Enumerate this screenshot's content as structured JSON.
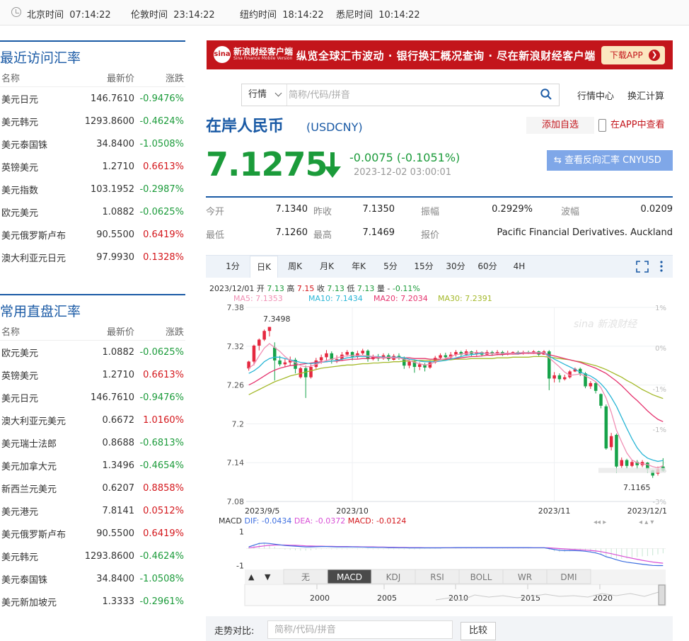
{
  "clocks": [
    {
      "city": "北京时间",
      "time": "07:14:22"
    },
    {
      "city": "伦敦时间",
      "time": "23:14:22"
    },
    {
      "city": "纽约时间",
      "time": "18:14:22"
    },
    {
      "city": "悉尼时间",
      "time": "10:14:22"
    }
  ],
  "recent": {
    "title": "最近访问汇率",
    "headers": [
      "名称",
      "最新价",
      "涨跌"
    ],
    "rows": [
      {
        "name": "美元日元",
        "price": "146.7610",
        "chg": "-0.9476%",
        "dir": "down"
      },
      {
        "name": "美元韩元",
        "price": "1293.8600",
        "chg": "-0.4624%",
        "dir": "down"
      },
      {
        "name": "美元泰国铢",
        "price": "34.8400",
        "chg": "-1.0508%",
        "dir": "down"
      },
      {
        "name": "英镑美元",
        "price": "1.2710",
        "chg": "0.6613%",
        "dir": "up"
      },
      {
        "name": "美元指数",
        "price": "103.1952",
        "chg": "-0.2987%",
        "dir": "down"
      },
      {
        "name": "欧元美元",
        "price": "1.0882",
        "chg": "-0.0625%",
        "dir": "down"
      },
      {
        "name": "美元俄罗斯卢布",
        "price": "90.5500",
        "chg": "0.6419%",
        "dir": "up"
      },
      {
        "name": "澳大利亚元日元",
        "price": "97.9930",
        "chg": "0.1328%",
        "dir": "up"
      }
    ]
  },
  "common": {
    "title": "常用直盘汇率",
    "headers": [
      "名称",
      "最新价",
      "涨跌"
    ],
    "rows": [
      {
        "name": "欧元美元",
        "price": "1.0882",
        "chg": "-0.0625%",
        "dir": "down"
      },
      {
        "name": "英镑美元",
        "price": "1.2710",
        "chg": "0.6613%",
        "dir": "up"
      },
      {
        "name": "美元日元",
        "price": "146.7610",
        "chg": "-0.9476%",
        "dir": "down"
      },
      {
        "name": "澳大利亚元美元",
        "price": "0.6672",
        "chg": "1.0160%",
        "dir": "up"
      },
      {
        "name": "美元瑞士法郎",
        "price": "0.8688",
        "chg": "-0.6813%",
        "dir": "down"
      },
      {
        "name": "美元加拿大元",
        "price": "1.3496",
        "chg": "-0.4654%",
        "dir": "down"
      },
      {
        "name": "新西兰元美元",
        "price": "0.6207",
        "chg": "0.8858%",
        "dir": "up"
      },
      {
        "name": "美元港元",
        "price": "7.8141",
        "chg": "0.0512%",
        "dir": "up"
      },
      {
        "name": "美元俄罗斯卢布",
        "price": "90.5500",
        "chg": "0.6419%",
        "dir": "up"
      },
      {
        "name": "美元韩元",
        "price": "1293.8600",
        "chg": "-0.4624%",
        "dir": "down"
      },
      {
        "name": "美元泰国铢",
        "price": "34.8400",
        "chg": "-1.0508%",
        "dir": "down"
      },
      {
        "name": "美元新加坡元",
        "price": "1.3333",
        "chg": "-0.2961%",
        "dir": "down"
      }
    ]
  },
  "banner": {
    "logo_text": "新浪财经客户端",
    "logo_sub": "Sina Finance Mobile Version",
    "logo_mark": "sina",
    "slogan": "纵览全球汇市波动 · 银行换汇概况查询 · 尽在新浪财经客户端",
    "download": "下载APP",
    "color": "#c3151b"
  },
  "search": {
    "select": "行情",
    "placeholder": "简称/代码/拼音",
    "links": [
      "行情中心",
      "换汇计算"
    ]
  },
  "quote": {
    "name": "在岸人民币",
    "code": "(USDCNY)",
    "add_fav": "添加自选",
    "app_view": "在APP中查看",
    "price": "7.1275",
    "change": "-0.0075 (-0.1051%)",
    "time": "2023-12-02 03:00:01",
    "reverse": "查看反向汇率 CNYUSD",
    "direction": "down"
  },
  "stats": [
    {
      "k": "今开",
      "v": "7.1340"
    },
    {
      "k": "昨收",
      "v": "7.1350"
    },
    {
      "k": "振幅",
      "v": "0.2929%"
    },
    {
      "k": "波幅",
      "v": "0.0209"
    },
    {
      "k": "最低",
      "v": "7.1260"
    },
    {
      "k": "最高",
      "v": "7.1469"
    },
    {
      "k": "报价",
      "v": "Pacific Financial Derivatives. Auckland"
    }
  ],
  "tabs": [
    "1分",
    "日K",
    "周K",
    "月K",
    "年K",
    "5分",
    "15分",
    "30分",
    "60分",
    "4H"
  ],
  "active_tab": "日K",
  "chart_data": {
    "type": "candlestick",
    "info_line": {
      "date": "2023/12/01",
      "open_label": "开",
      "open": "7.13",
      "high_label": "高",
      "high": "7.15",
      "close_label": "收",
      "close": "7.13",
      "low_label": "低",
      "low": "7.13",
      "vol_label": "量",
      "vol": "-",
      "pct": "-0.11%"
    },
    "ma_labels": [
      {
        "name": "MA5:",
        "value": "7.1353",
        "color": "#f08fb4"
      },
      {
        "name": "MA10:",
        "value": "7.1434",
        "color": "#2ab6d6"
      },
      {
        "name": "MA20:",
        "value": "7.2034",
        "color": "#e5336e"
      },
      {
        "name": "MA30:",
        "value": "7.2391",
        "color": "#a4b92a"
      }
    ],
    "y_ticks": [
      "7.38",
      "7.32",
      "7.26",
      "7.2",
      "7.14",
      "7.08"
    ],
    "pct_ticks": [
      "1%",
      "0%",
      "-1%",
      "-1%",
      "-2%",
      "-3%"
    ],
    "x_ticks": [
      "2023/9/5",
      "2023/10",
      "2023/11",
      "2023/12/1"
    ],
    "ylim": [
      7.08,
      7.38
    ],
    "max_label": "7.3498",
    "min_label": "7.1165",
    "watermark": "sina 新浪财经",
    "candles": [
      [
        7.2856,
        7.2962,
        7.2822,
        7.2975
      ],
      [
        7.2962,
        7.3209,
        7.2905,
        7.3224
      ],
      [
        7.3209,
        7.3302,
        7.3135,
        7.332
      ],
      [
        7.3302,
        7.3436,
        7.328,
        7.3458
      ],
      [
        7.3436,
        7.3498,
        7.3351,
        7.3498
      ],
      [
        7.318,
        7.298,
        7.267,
        7.326
      ],
      [
        7.298,
        7.292,
        7.289,
        7.305
      ],
      [
        7.292,
        7.295,
        7.288,
        7.301
      ],
      [
        7.295,
        7.299,
        7.29,
        7.304
      ],
      [
        7.299,
        7.285,
        7.278,
        7.302
      ],
      [
        7.272,
        7.286,
        7.27,
        7.288
      ],
      [
        7.286,
        7.272,
        7.24,
        7.29
      ],
      [
        7.272,
        7.288,
        7.27,
        7.292
      ],
      [
        7.288,
        7.298,
        7.285,
        7.302
      ],
      [
        7.298,
        7.303,
        7.293,
        7.307
      ],
      [
        7.303,
        7.309,
        7.297,
        7.314
      ],
      [
        7.309,
        7.299,
        7.293,
        7.312
      ],
      [
        7.299,
        7.3,
        7.294,
        7.306
      ],
      [
        7.3,
        7.307,
        7.297,
        7.311
      ],
      [
        7.307,
        7.311,
        7.304,
        7.314
      ],
      [
        7.311,
        7.304,
        7.298,
        7.312
      ],
      [
        7.304,
        7.309,
        7.301,
        7.313
      ],
      [
        7.309,
        7.313,
        7.306,
        7.316
      ],
      [
        7.313,
        7.3,
        7.296,
        7.315
      ],
      [
        7.3,
        7.304,
        7.298,
        7.307
      ],
      [
        7.304,
        7.301,
        7.297,
        7.308
      ],
      [
        7.301,
        7.306,
        7.299,
        7.309
      ],
      [
        7.306,
        7.3,
        7.297,
        7.309
      ],
      [
        7.299,
        7.305,
        7.298,
        7.308
      ],
      [
        7.305,
        7.302,
        7.299,
        7.309
      ],
      [
        7.302,
        7.29,
        7.285,
        7.304
      ],
      [
        7.29,
        7.296,
        7.286,
        7.3
      ],
      [
        7.296,
        7.288,
        7.279,
        7.299
      ],
      [
        7.288,
        7.292,
        7.283,
        7.295
      ],
      [
        7.292,
        7.287,
        7.281,
        7.294
      ],
      [
        7.287,
        7.295,
        7.285,
        7.298
      ],
      [
        7.295,
        7.302,
        7.293,
        7.305
      ],
      [
        7.302,
        7.306,
        7.299,
        7.309
      ],
      [
        7.306,
        7.303,
        7.3,
        7.31
      ],
      [
        7.303,
        7.307,
        7.301,
        7.311
      ],
      [
        7.307,
        7.311,
        7.304,
        7.314
      ],
      [
        7.311,
        7.307,
        7.304,
        7.313
      ],
      [
        7.307,
        7.312,
        7.305,
        7.315
      ],
      [
        7.312,
        7.308,
        7.305,
        7.313
      ],
      [
        7.308,
        7.311,
        7.305,
        7.314
      ],
      [
        7.311,
        7.307,
        7.304,
        7.312
      ],
      [
        7.307,
        7.311,
        7.306,
        7.314
      ],
      [
        7.311,
        7.308,
        7.305,
        7.313
      ],
      [
        7.308,
        7.311,
        7.306,
        7.314
      ],
      [
        7.311,
        7.307,
        7.305,
        7.313
      ],
      [
        7.307,
        7.31,
        7.306,
        7.313
      ],
      [
        7.31,
        7.311,
        7.307,
        7.312
      ],
      [
        7.311,
        7.309,
        7.307,
        7.313
      ],
      [
        7.309,
        7.311,
        7.307,
        7.313
      ],
      [
        7.311,
        7.31,
        7.308,
        7.313
      ],
      [
        7.31,
        7.312,
        7.308,
        7.314
      ],
      [
        7.312,
        7.307,
        7.305,
        7.313
      ],
      [
        7.307,
        7.312,
        7.307,
        7.314
      ],
      [
        7.312,
        7.27,
        7.252,
        7.314
      ],
      [
        7.27,
        7.275,
        7.264,
        7.28
      ],
      [
        7.275,
        7.269,
        7.264,
        7.278
      ],
      [
        7.269,
        7.272,
        7.267,
        7.276
      ],
      [
        7.272,
        7.281,
        7.27,
        7.283
      ],
      [
        7.281,
        7.285,
        7.28,
        7.287
      ],
      [
        7.285,
        7.278,
        7.274,
        7.287
      ],
      [
        7.278,
        7.258,
        7.255,
        7.28
      ],
      [
        7.258,
        7.263,
        7.254,
        7.266
      ],
      [
        7.263,
        7.251,
        7.247,
        7.265
      ],
      [
        7.246,
        7.228,
        7.224,
        7.247
      ],
      [
        7.227,
        7.162,
        7.16,
        7.23
      ],
      [
        7.164,
        7.181,
        7.159,
        7.186
      ],
      [
        7.183,
        7.134,
        7.124,
        7.185
      ],
      [
        7.135,
        7.144,
        7.132,
        7.148
      ],
      [
        7.144,
        7.135,
        7.131,
        7.146
      ],
      [
        7.135,
        7.141,
        7.133,
        7.144
      ],
      [
        7.141,
        7.136,
        7.13,
        7.144
      ],
      [
        7.136,
        7.141,
        7.133,
        7.144
      ],
      [
        7.14,
        7.13,
        7.124,
        7.141
      ],
      [
        7.128,
        7.12,
        7.1165,
        7.129
      ],
      [
        7.123,
        7.13,
        7.12,
        7.134
      ],
      [
        7.134,
        7.1275,
        7.126,
        7.1469
      ]
    ],
    "ma5": [
      7.286,
      7.292,
      7.305,
      7.317,
      7.324,
      7.318,
      7.312,
      7.304,
      7.298,
      7.295,
      7.29,
      7.288,
      7.289,
      7.292,
      7.295,
      7.298,
      7.3,
      7.302,
      7.304,
      7.305,
      7.306,
      7.306,
      7.306,
      7.305,
      7.304,
      7.303,
      7.302,
      7.303,
      7.302,
      7.302,
      7.3,
      7.298,
      7.295,
      7.293,
      7.291,
      7.292,
      7.296,
      7.299,
      7.301,
      7.304,
      7.307,
      7.308,
      7.309,
      7.31,
      7.31,
      7.31,
      7.309,
      7.309,
      7.309,
      7.309,
      7.309,
      7.309,
      7.31,
      7.31,
      7.31,
      7.31,
      7.31,
      7.31,
      7.302,
      7.295,
      7.288,
      7.28,
      7.275,
      7.276,
      7.277,
      7.274,
      7.27,
      7.265,
      7.256,
      7.24,
      7.218,
      7.19,
      7.172,
      7.155,
      7.144,
      7.14,
      7.138,
      7.137,
      7.134,
      7.132,
      7.1353
    ],
    "ma10": [
      7.278,
      7.282,
      7.288,
      7.296,
      7.301,
      7.303,
      7.303,
      7.301,
      7.299,
      7.297,
      7.295,
      7.294,
      7.293,
      7.294,
      7.295,
      7.296,
      7.297,
      7.298,
      7.3,
      7.302,
      7.303,
      7.304,
      7.304,
      7.304,
      7.304,
      7.304,
      7.303,
      7.303,
      7.303,
      7.303,
      7.302,
      7.3,
      7.299,
      7.297,
      7.296,
      7.296,
      7.296,
      7.297,
      7.298,
      7.3,
      7.302,
      7.304,
      7.306,
      7.307,
      7.308,
      7.309,
      7.309,
      7.309,
      7.309,
      7.309,
      7.309,
      7.309,
      7.309,
      7.31,
      7.31,
      7.31,
      7.31,
      7.31,
      7.305,
      7.3,
      7.296,
      7.292,
      7.288,
      7.284,
      7.28,
      7.277,
      7.274,
      7.269,
      7.262,
      7.253,
      7.241,
      7.227,
      7.21,
      7.193,
      7.177,
      7.163,
      7.153,
      7.147,
      7.144,
      7.142,
      7.1434
    ],
    "ma20": [
      7.26,
      7.264,
      7.269,
      7.274,
      7.279,
      7.283,
      7.286,
      7.288,
      7.29,
      7.291,
      7.292,
      7.293,
      7.294,
      7.295,
      7.296,
      7.296,
      7.297,
      7.297,
      7.298,
      7.299,
      7.3,
      7.3,
      7.301,
      7.301,
      7.302,
      7.302,
      7.302,
      7.302,
      7.302,
      7.302,
      7.302,
      7.302,
      7.301,
      7.301,
      7.301,
      7.3,
      7.3,
      7.3,
      7.3,
      7.301,
      7.301,
      7.302,
      7.303,
      7.304,
      7.304,
      7.305,
      7.306,
      7.306,
      7.307,
      7.307,
      7.308,
      7.308,
      7.308,
      7.309,
      7.309,
      7.309,
      7.309,
      7.309,
      7.307,
      7.305,
      7.303,
      7.301,
      7.299,
      7.297,
      7.295,
      7.292,
      7.289,
      7.286,
      7.282,
      7.278,
      7.272,
      7.266,
      7.259,
      7.251,
      7.243,
      7.236,
      7.228,
      7.22,
      7.213,
      7.207,
      7.2034
    ],
    "ma30": [
      7.245,
      7.249,
      7.253,
      7.257,
      7.261,
      7.265,
      7.268,
      7.271,
      7.274,
      7.276,
      7.278,
      7.28,
      7.282,
      7.284,
      7.286,
      7.287,
      7.288,
      7.289,
      7.29,
      7.291,
      7.291,
      7.292,
      7.293,
      7.293,
      7.294,
      7.294,
      7.295,
      7.295,
      7.296,
      7.296,
      7.297,
      7.297,
      7.297,
      7.298,
      7.298,
      7.298,
      7.298,
      7.299,
      7.299,
      7.299,
      7.3,
      7.3,
      7.3,
      7.301,
      7.301,
      7.301,
      7.301,
      7.301,
      7.302,
      7.302,
      7.302,
      7.303,
      7.303,
      7.303,
      7.303,
      7.304,
      7.304,
      7.304,
      7.303,
      7.302,
      7.301,
      7.3,
      7.299,
      7.297,
      7.296,
      7.294,
      7.292,
      7.29,
      7.287,
      7.284,
      7.28,
      7.276,
      7.272,
      7.267,
      7.263,
      7.258,
      7.253,
      7.249,
      7.245,
      7.242,
      7.2391
    ],
    "macd": {
      "label": "MACD",
      "dif_label": "DIF:",
      "dif": "-0.0434",
      "dea_label": "DEA:",
      "dea": "-0.0372",
      "macd_label": "MACD:",
      "macd_val": "-0.0124",
      "y_ticks": [
        "1",
        "-1"
      ],
      "dif_line": [
        0.1,
        0.2,
        0.3,
        0.32,
        0.3,
        0.26,
        0.22,
        0.18,
        0.16,
        0.14,
        0.12,
        0.1,
        0.1,
        0.11,
        0.12,
        0.12,
        0.11,
        0.1,
        0.1,
        0.1,
        0.1,
        0.09,
        0.09,
        0.08,
        0.08,
        0.07,
        0.07,
        0.06,
        0.06,
        0.05,
        0.05,
        0.04,
        0.04,
        0.04,
        0.04,
        0.04,
        0.04,
        0.04,
        0.05,
        0.05,
        0.06,
        0.06,
        0.06,
        0.06,
        0.06,
        0.06,
        0.06,
        0.06,
        0.06,
        0.06,
        0.06,
        0.06,
        0.06,
        0.06,
        0.06,
        0.05,
        0.05,
        0.05,
        0.0,
        -0.06,
        -0.1,
        -0.12,
        -0.12,
        -0.12,
        -0.13,
        -0.16,
        -0.2,
        -0.26,
        -0.34,
        -0.48,
        -0.56,
        -0.66,
        -0.74,
        -0.8,
        -0.84,
        -0.88,
        -0.92,
        -0.96,
        -0.99,
        -1.0,
        -1.0
      ],
      "dea_line": [
        0.05,
        0.08,
        0.12,
        0.16,
        0.19,
        0.21,
        0.21,
        0.21,
        0.2,
        0.19,
        0.18,
        0.16,
        0.15,
        0.14,
        0.14,
        0.13,
        0.13,
        0.12,
        0.12,
        0.12,
        0.11,
        0.11,
        0.1,
        0.1,
        0.1,
        0.09,
        0.09,
        0.08,
        0.08,
        0.07,
        0.07,
        0.06,
        0.06,
        0.06,
        0.05,
        0.05,
        0.05,
        0.05,
        0.05,
        0.05,
        0.05,
        0.05,
        0.05,
        0.05,
        0.05,
        0.05,
        0.05,
        0.05,
        0.05,
        0.05,
        0.05,
        0.05,
        0.05,
        0.05,
        0.05,
        0.05,
        0.05,
        0.05,
        0.04,
        0.02,
        0.0,
        -0.02,
        -0.04,
        -0.06,
        -0.07,
        -0.09,
        -0.11,
        -0.14,
        -0.18,
        -0.24,
        -0.3,
        -0.37,
        -0.44,
        -0.51,
        -0.57,
        -0.63,
        -0.69,
        -0.74,
        -0.79,
        -0.83,
        -0.86
      ]
    },
    "indicator_tabs": [
      "无",
      "MACD",
      "KDJ",
      "RSI",
      "BOLL",
      "WR",
      "DMI"
    ],
    "active_indicator": "MACD",
    "nav_years": [
      "2000",
      "2005",
      "2010",
      "2015",
      "2020"
    ]
  },
  "compare": {
    "label": "走势对比:",
    "placeholder": "简称/代码/拼音",
    "button": "比较"
  }
}
